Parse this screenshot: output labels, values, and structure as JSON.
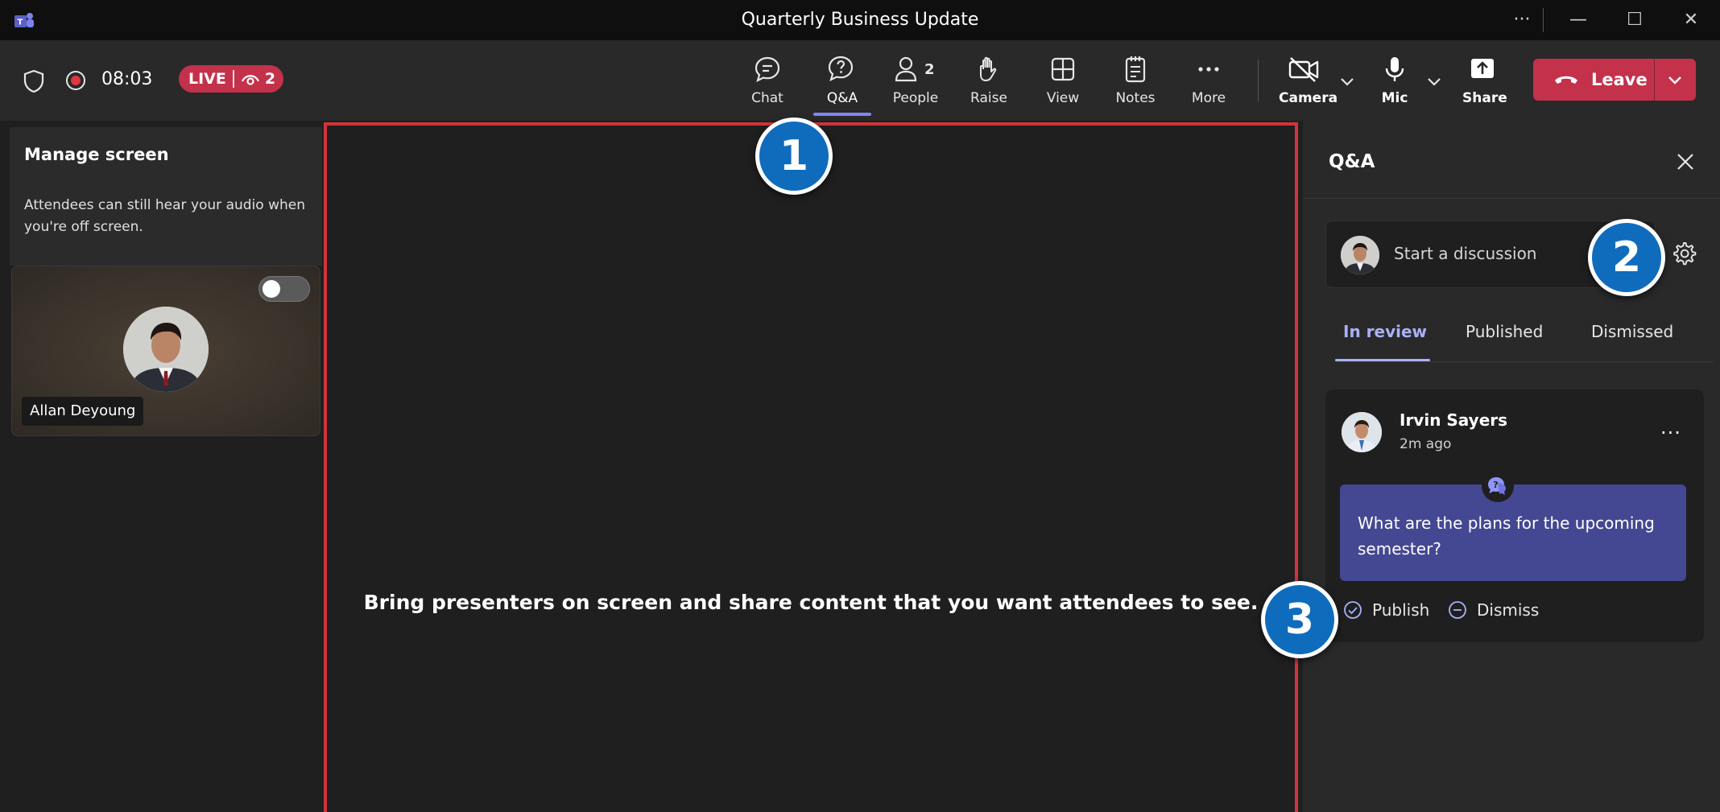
{
  "window": {
    "title": "Quarterly Business Update",
    "more_label": "···",
    "minimize_label": "—",
    "maximize_label": "☐",
    "close_label": "✕"
  },
  "toolbar": {
    "timer": "08:03",
    "live_label": "LIVE",
    "viewer_count": "2",
    "people_count": "2",
    "items": [
      {
        "id": "chat",
        "label": "Chat",
        "icon": "chat-icon"
      },
      {
        "id": "qa",
        "label": "Q&A",
        "icon": "qa-icon",
        "active": true
      },
      {
        "id": "people",
        "label": "People",
        "icon": "people-icon"
      },
      {
        "id": "raise",
        "label": "Raise",
        "icon": "raise-hand-icon"
      },
      {
        "id": "view",
        "label": "View",
        "icon": "view-grid-icon"
      },
      {
        "id": "notes",
        "label": "Notes",
        "icon": "notes-icon"
      },
      {
        "id": "more",
        "label": "More",
        "icon": "more-icon"
      },
      {
        "id": "camera",
        "label": "Camera",
        "icon": "camera-off-icon"
      },
      {
        "id": "mic",
        "label": "Mic",
        "icon": "mic-icon"
      },
      {
        "id": "share",
        "label": "Share",
        "icon": "share-icon"
      }
    ],
    "leave_label": "Leave",
    "accent_color": "#7f85f5",
    "leave_color": "#c4314b"
  },
  "left_panel": {
    "title": "Manage screen",
    "description": "Attendees can still hear your audio when you're off screen.",
    "tile": {
      "name": "Allan Deyoung",
      "toggle_on": false
    }
  },
  "stage": {
    "message": "Bring presenters on screen and share content that you want attendees to see.",
    "border_color": "#d13438"
  },
  "qa_panel": {
    "title": "Q&A",
    "discussion_placeholder": "Start a discussion",
    "tabs": [
      {
        "label": "In review",
        "active": true
      },
      {
        "label": "Published",
        "active": false
      },
      {
        "label": "Dismissed",
        "active": false
      }
    ],
    "question": {
      "author": "Irvin Sayers",
      "time": "2m ago",
      "text": "What are the plans for the upcoming semester?",
      "more_label": "···",
      "publish_label": "Publish",
      "dismiss_label": "Dismiss",
      "bubble_color": "#444791"
    }
  },
  "callouts": [
    "1",
    "2",
    "3"
  ]
}
